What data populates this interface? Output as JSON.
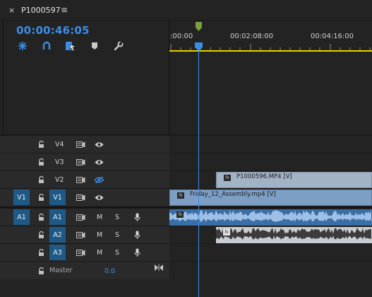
{
  "tab": {
    "close": "×",
    "title": "P1000597",
    "menu": "≡"
  },
  "timecode": "00:00:46:05",
  "toolbar": [
    {
      "name": "snap-icon"
    },
    {
      "name": "magnet-icon"
    },
    {
      "name": "linked-selection-icon"
    },
    {
      "name": "marker-icon"
    },
    {
      "name": "wrench-icon"
    }
  ],
  "ruler": {
    "labels": [
      ":00:00",
      "00:02:08:00",
      "00:04:16:00"
    ]
  },
  "tracks": {
    "V4": {
      "label": "V4"
    },
    "V3": {
      "label": "V3"
    },
    "V2": {
      "label": "V2"
    },
    "V1": {
      "source": "V1",
      "label": "V1"
    },
    "A1": {
      "source": "A1",
      "label": "A1",
      "m": "M",
      "s": "S"
    },
    "A2": {
      "label": "A2",
      "m": "M",
      "s": "S"
    },
    "A3": {
      "label": "A3",
      "m": "M",
      "s": "S"
    },
    "master": {
      "label": "Master",
      "value": "0.0"
    }
  },
  "clips": {
    "v2": {
      "name": "P1000596.MP4 [V]",
      "fx": "fx"
    },
    "v1": {
      "name": "Friday_12_Assembly.mp4 [V]",
      "fx": "fx"
    },
    "a1": {
      "fx": "fx"
    },
    "a2": {
      "fx": "fx"
    }
  },
  "colors": {
    "accent": "#3b8ee8",
    "track_patch": "#1f5a86",
    "work_area": "#e6d200",
    "video_clip": "#a3b3c6",
    "audio_clip": "#3a6ea6"
  }
}
